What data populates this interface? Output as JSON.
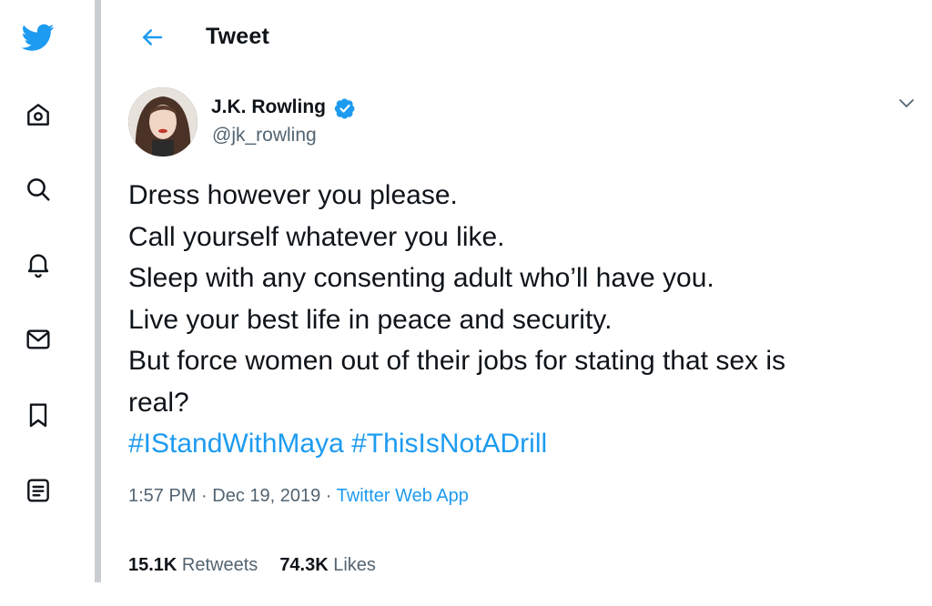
{
  "header": {
    "title": "Tweet"
  },
  "sidebar": {
    "icons": [
      "twitter-logo",
      "home-icon",
      "explore-icon",
      "notifications-icon",
      "messages-icon",
      "bookmarks-icon",
      "lists-icon"
    ]
  },
  "author": {
    "name": "J.K. Rowling",
    "handle": "@jk_rowling",
    "verified": true
  },
  "tweet": {
    "lines": [
      "Dress however you please.",
      "Call yourself whatever you like.",
      "Sleep with any consenting adult who’ll have you.",
      "Live your best life in peace and security.",
      "But force women out of their jobs for stating that sex is",
      "real?"
    ],
    "hashtags": [
      "#IStandWithMaya",
      "#ThisIsNotADrill"
    ]
  },
  "meta": {
    "time": "1:57 PM",
    "sep1": " · ",
    "date": "Dec 19, 2019",
    "sep2": " · ",
    "source": "Twitter Web App"
  },
  "stats": {
    "retweets_count": "15.1K",
    "retweets_label": " Retweets",
    "likes_count": "74.3K",
    "likes_label": " Likes"
  },
  "colors": {
    "accent": "#1d9bf0",
    "text": "#0f1419",
    "secondary": "#536471",
    "divider": "#c9cdd1"
  }
}
